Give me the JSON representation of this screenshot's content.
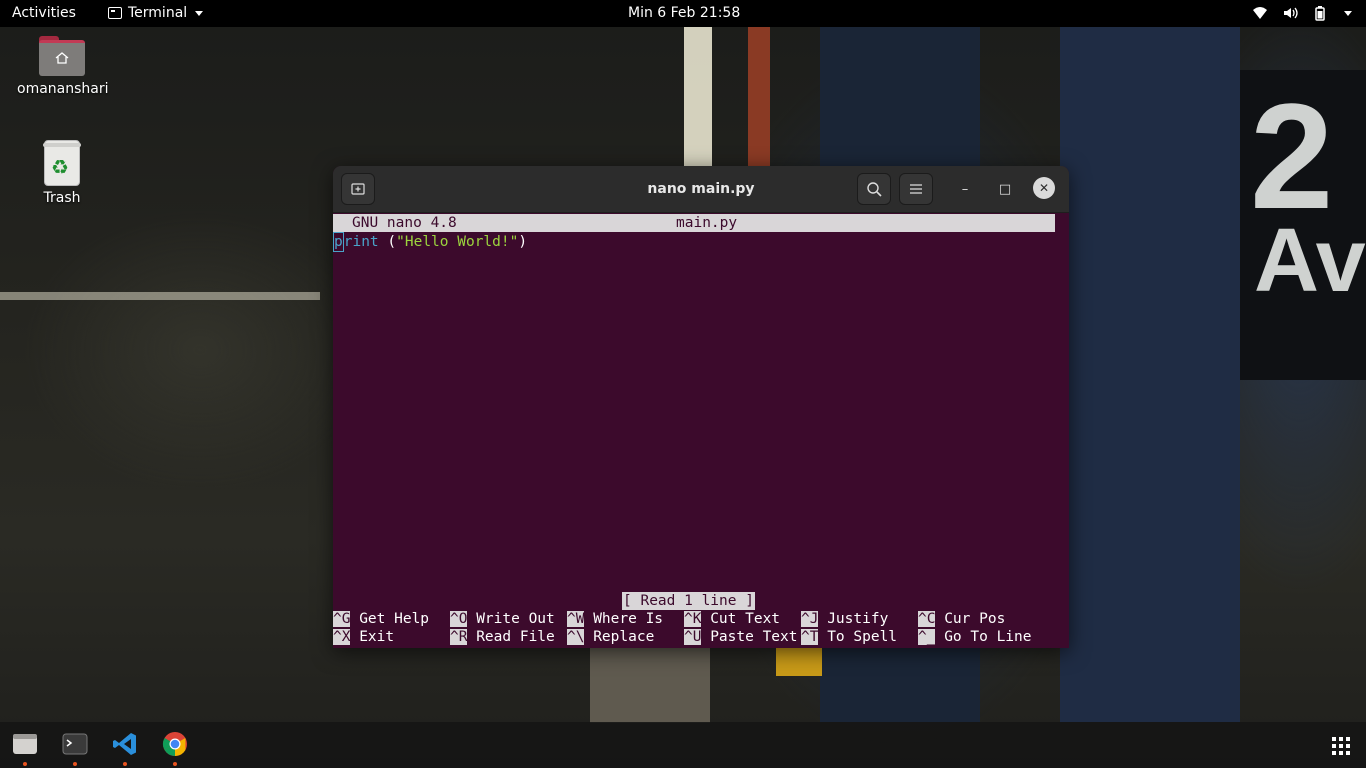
{
  "topbar": {
    "activities": "Activities",
    "app_menu": "Terminal",
    "clock": "Min  6 Feb  21:58",
    "tray_icons": [
      "wifi-icon",
      "volume-icon",
      "battery-icon",
      "power-menu-icon"
    ]
  },
  "desktop": {
    "home_label": "omananshari",
    "trash_label": "Trash",
    "background_sign_number": "2",
    "background_sign_text": "Ave"
  },
  "window": {
    "title": "nano main.py",
    "new_tab_icon": "new-tab-icon",
    "search_icon": "search-icon",
    "menu_icon": "hamburger-menu-icon",
    "minimize_glyph": "–",
    "maximize_glyph": "□",
    "close_glyph": "✕"
  },
  "nano": {
    "version": "GNU nano 4.8",
    "filename": "main.py",
    "code_keyword": "print",
    "code_open": " (",
    "code_string": "\"Hello World!\"",
    "code_close": ")",
    "status": "[ Read 1 line ]",
    "shortcuts": [
      {
        "key": "^G",
        "label": "Get Help"
      },
      {
        "key": "^O",
        "label": "Write Out"
      },
      {
        "key": "^W",
        "label": "Where Is"
      },
      {
        "key": "^K",
        "label": "Cut Text"
      },
      {
        "key": "^J",
        "label": "Justify"
      },
      {
        "key": "^C",
        "label": "Cur Pos"
      },
      {
        "key": "^X",
        "label": "Exit"
      },
      {
        "key": "^R",
        "label": "Read File"
      },
      {
        "key": "^\\",
        "label": "Replace"
      },
      {
        "key": "^U",
        "label": "Paste Text"
      },
      {
        "key": "^T",
        "label": "To Spell"
      },
      {
        "key": "^_",
        "label": "Go To Line"
      }
    ]
  },
  "dock": {
    "items": [
      "files-icon",
      "terminal-icon",
      "vscode-icon",
      "chrome-icon"
    ],
    "show_apps": "show-applications-icon"
  },
  "colors": {
    "terminal_bg": "#3c0a2c",
    "keyword": "#4aa3c9",
    "string": "#9bd43e",
    "accent": "#e95420"
  }
}
